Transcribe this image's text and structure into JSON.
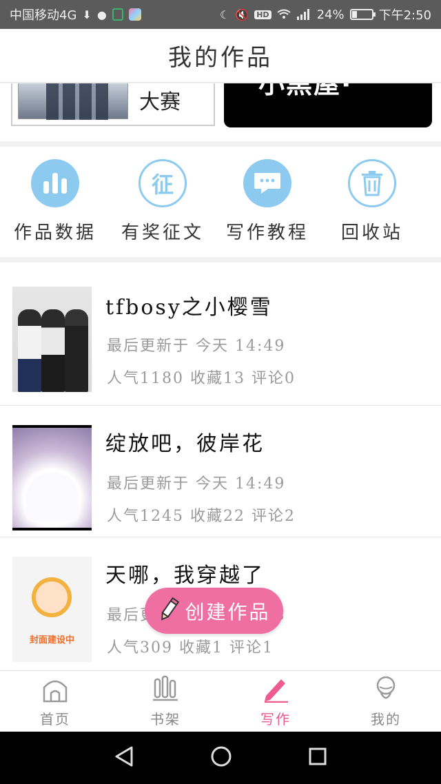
{
  "status_bar": {
    "carrier": "中国移动4G",
    "network_badge": "HD",
    "signal_label": "4G",
    "battery": "24%",
    "time": "下午2:50",
    "battery_level": 0.24
  },
  "header": {
    "title": "我的作品"
  },
  "banners": [
    {
      "text": "大赛"
    },
    {
      "text": "小黑屋·"
    }
  ],
  "tools": [
    {
      "label": "作品数据",
      "icon": "bar-chart-icon"
    },
    {
      "label": "有奖征文",
      "icon": "zheng-icon",
      "glyph": "征"
    },
    {
      "label": "写作教程",
      "icon": "chat-bubble-icon"
    },
    {
      "label": "回收站",
      "icon": "trash-icon"
    }
  ],
  "works": [
    {
      "title": "tfbosy之小樱雪",
      "updated": "最后更新于 今天 14:49",
      "stats": "人气1180 收藏13 评论0"
    },
    {
      "title": "绽放吧，彼岸花",
      "updated": "最后更新于 今天 14:49",
      "stats": "人气1245 收藏22 评论2"
    },
    {
      "title": "天哪，我穿越了",
      "updated": "最后更新于 今天 14:48",
      "stats": "人气309 收藏1 评论1",
      "cover_text": "封面建设中"
    }
  ],
  "create_button": {
    "label": "创建作品"
  },
  "bottom_nav": [
    {
      "label": "首页",
      "icon": "home-icon",
      "active": false
    },
    {
      "label": "书架",
      "icon": "bookshelf-icon",
      "active": false
    },
    {
      "label": "写作",
      "icon": "pencil-icon",
      "active": true
    },
    {
      "label": "我的",
      "icon": "profile-icon",
      "active": false
    }
  ],
  "colors": {
    "accent_blue": "#8ccaf0",
    "accent_pink": "#f06fa3",
    "active_tab": "#ef5b8f"
  }
}
